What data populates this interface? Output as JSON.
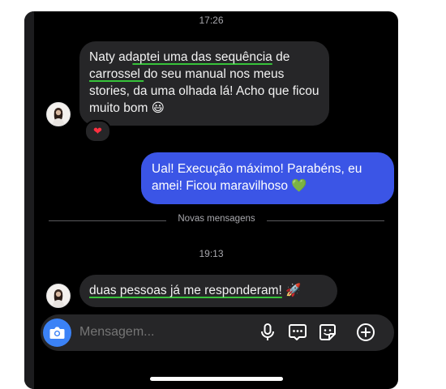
{
  "chat": {
    "timestamp_1": "17:26",
    "timestamp_2": "19:13",
    "divider_label": "Novas mensagens",
    "messages": [
      {
        "direction": "incoming",
        "parts": [
          "Naty ad",
          "aptei uma das sequência",
          " de ",
          "carrossel ",
          "do seu manual nos meus stories, da uma olhada lá! Acho que ficou muito bom ",
          "😃"
        ],
        "reaction": "❤"
      },
      {
        "direction": "outgoing",
        "text": "Ual! Execução máximo! Parabéns, eu amei! Ficou maravilhoso ",
        "emoji": "💚"
      },
      {
        "direction": "incoming",
        "text": "duas pessoas já me responderam!",
        "emoji": "🚀"
      }
    ]
  },
  "composer": {
    "placeholder": "Mensagem...",
    "icons": [
      "camera-icon",
      "microphone-icon",
      "chat-bubble-icon",
      "sticker-icon",
      "plus-icon"
    ]
  },
  "colors": {
    "background": "#000000",
    "incoming_bubble": "#262628",
    "outgoing_bubble": "#3b55e6",
    "underline": "#37c23a",
    "camera": "#3b82f6"
  }
}
